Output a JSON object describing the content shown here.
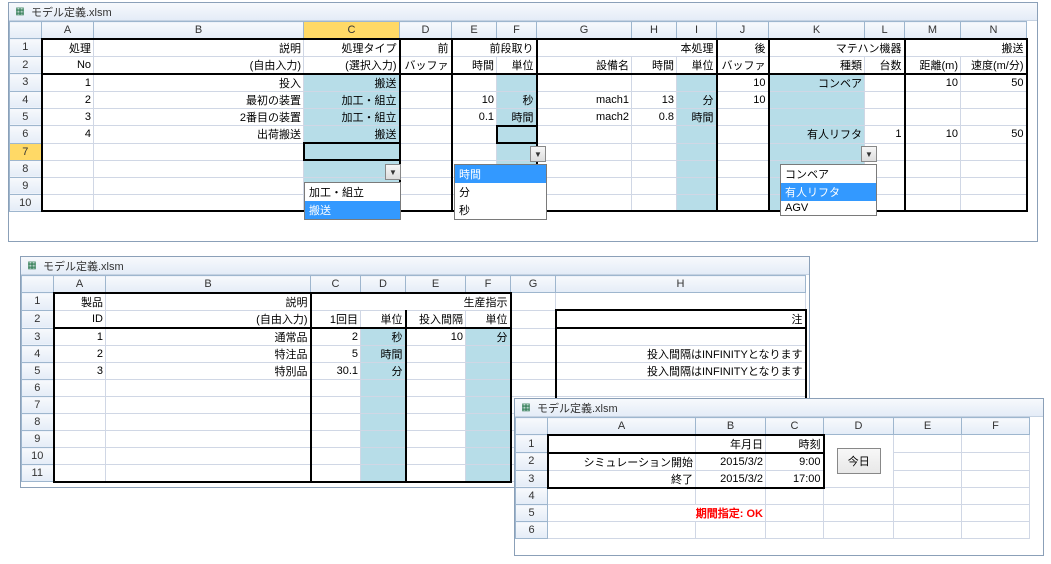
{
  "window_title": "モデル定義.xlsm",
  "top": {
    "cols": [
      "A",
      "B",
      "C",
      "D",
      "E",
      "F",
      "G",
      "H",
      "I",
      "J",
      "K",
      "L",
      "M",
      "N"
    ],
    "h1": {
      "no": "処理",
      "desc": "説明",
      "ptype": "処理タイプ",
      "pre": "前",
      "pre_setup": "前段取り",
      "main": "本処理",
      "post": "後",
      "mh": "マテハン機器",
      "trans": "搬送"
    },
    "h2": {
      "no": "No",
      "desc": "(自由入力)",
      "ptype": "(選択入力)",
      "buf": "バッファ",
      "time": "時間",
      "unit": "単位",
      "equip": "設備名",
      "kind": "種類",
      "count": "台数",
      "dist": "距離(m)",
      "speed": "速度(m/分)"
    },
    "rows": [
      {
        "n": 3,
        "no": "1",
        "desc": "投入",
        "ptype": "搬送",
        "pre": "",
        "pt": "",
        "pu": "",
        "equip": "",
        "mt": "",
        "mu": "",
        "post": "10",
        "kind": "コンベア",
        "cnt": "",
        "dist": "10",
        "spd": "50"
      },
      {
        "n": 4,
        "no": "2",
        "desc": "最初の装置",
        "ptype": "加工・組立",
        "pre": "",
        "pt": "10",
        "pu": "秒",
        "equip": "mach1",
        "mt": "13",
        "mu": "分",
        "post": "10",
        "kind": "",
        "cnt": "",
        "dist": "",
        "spd": ""
      },
      {
        "n": 5,
        "no": "3",
        "desc": "2番目の装置",
        "ptype": "加工・組立",
        "pre": "",
        "pt": "0.1",
        "pu": "時間",
        "equip": "mach2",
        "mt": "0.8",
        "mu": "時間",
        "post": "",
        "kind": "",
        "cnt": "",
        "dist": "",
        "spd": ""
      },
      {
        "n": 6,
        "no": "4",
        "desc": "出荷搬送",
        "ptype": "搬送",
        "pre": "",
        "pt": "",
        "pu": "",
        "equip": "",
        "mt": "",
        "mu": "",
        "post": "",
        "kind": "有人リフタ",
        "cnt": "1",
        "dist": "10",
        "spd": "50"
      }
    ],
    "empty_rows": [
      7,
      8,
      9,
      10
    ],
    "dd_ptype": [
      "加工・組立",
      "搬送"
    ],
    "dd_unit": [
      "時間",
      "分",
      "秒"
    ],
    "dd_kind": [
      "コンベア",
      "有人リフタ",
      "AGV"
    ]
  },
  "mid": {
    "cols": [
      "A",
      "B",
      "C",
      "D",
      "E",
      "F",
      "G",
      "H"
    ],
    "h1": {
      "prod": "製品",
      "desc": "説明",
      "inst": "生産指示"
    },
    "h2": {
      "id": "ID",
      "desc": "(自由入力)",
      "first": "1回目",
      "unit": "単位",
      "ival": "投入間隔",
      "note": "注"
    },
    "rows": [
      {
        "n": 3,
        "id": "1",
        "desc": "通常品",
        "first": "2",
        "unit": "秒",
        "ival": "10",
        "iunit": "分",
        "note": ""
      },
      {
        "n": 4,
        "id": "2",
        "desc": "特注品",
        "first": "5",
        "unit": "時間",
        "ival": "",
        "iunit": "",
        "note": "投入間隔はINFINITYとなります"
      },
      {
        "n": 5,
        "id": "3",
        "desc": "特別品",
        "first": "30.1",
        "unit": "分",
        "ival": "",
        "iunit": "",
        "note": "投入間隔はINFINITYとなります"
      }
    ],
    "empty_rows": [
      6,
      7,
      8,
      9,
      10,
      11
    ]
  },
  "bot": {
    "cols": [
      "A",
      "B",
      "C",
      "D",
      "E",
      "F"
    ],
    "h": {
      "date": "年月日",
      "time": "時刻"
    },
    "rows": [
      {
        "n": 2,
        "label": "シミュレーション開始",
        "date": "2015/3/2",
        "time": "9:00"
      },
      {
        "n": 3,
        "label": "終了",
        "date": "2015/3/2",
        "time": "17:00"
      }
    ],
    "today": "今日",
    "status": "期間指定: OK",
    "empty_rows": [
      4,
      5,
      6
    ]
  }
}
